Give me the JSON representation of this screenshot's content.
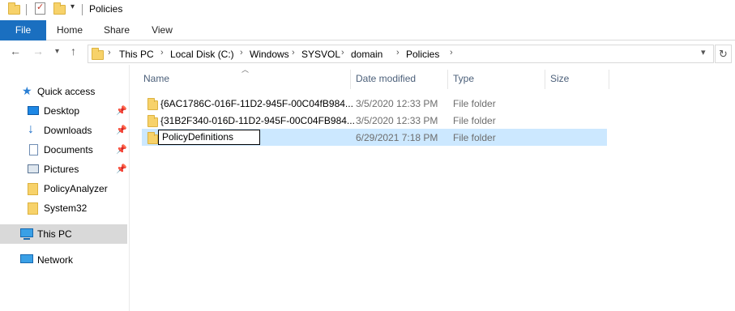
{
  "window": {
    "title": "Policies"
  },
  "ribbon": {
    "tabs": [
      "File",
      "Home",
      "Share",
      "View"
    ]
  },
  "address": {
    "crumbs": [
      "This PC",
      "Local Disk (C:)",
      "Windows",
      "SYSVOL",
      "domain",
      "Policies"
    ]
  },
  "nav": {
    "quick_access": "Quick access",
    "items": [
      {
        "label": "Desktop",
        "icon": "desktop-icon",
        "pinned": true
      },
      {
        "label": "Downloads",
        "icon": "download-arrow-icon",
        "pinned": true
      },
      {
        "label": "Documents",
        "icon": "documents-icon",
        "pinned": true
      },
      {
        "label": "Pictures",
        "icon": "pictures-icon",
        "pinned": true
      },
      {
        "label": "PolicyAnalyzer",
        "icon": "folder-icon",
        "pinned": false
      },
      {
        "label": "System32",
        "icon": "folder-icon",
        "pinned": false
      }
    ],
    "this_pc": "This PC",
    "network": "Network"
  },
  "columns": {
    "name": "Name",
    "date": "Date modified",
    "type": "Type",
    "size": "Size"
  },
  "files": [
    {
      "name": "{6AC1786C-016F-11D2-945F-00C04fB984...",
      "date": "3/5/2020 12:33 PM",
      "type": "File folder"
    },
    {
      "name": "{31B2F340-016D-11D2-945F-00C04FB984...",
      "date": "3/5/2020 12:33 PM",
      "type": "File folder"
    },
    {
      "name": "PolicyDefinitions",
      "date": "6/29/2021 7:18 PM",
      "type": "File folder",
      "renaming": true
    }
  ],
  "colors": {
    "file_tab": "#1a6fc0",
    "selection": "#cce8ff",
    "nav_selected": "#d9d9d9",
    "folder": "#f7d26a"
  }
}
